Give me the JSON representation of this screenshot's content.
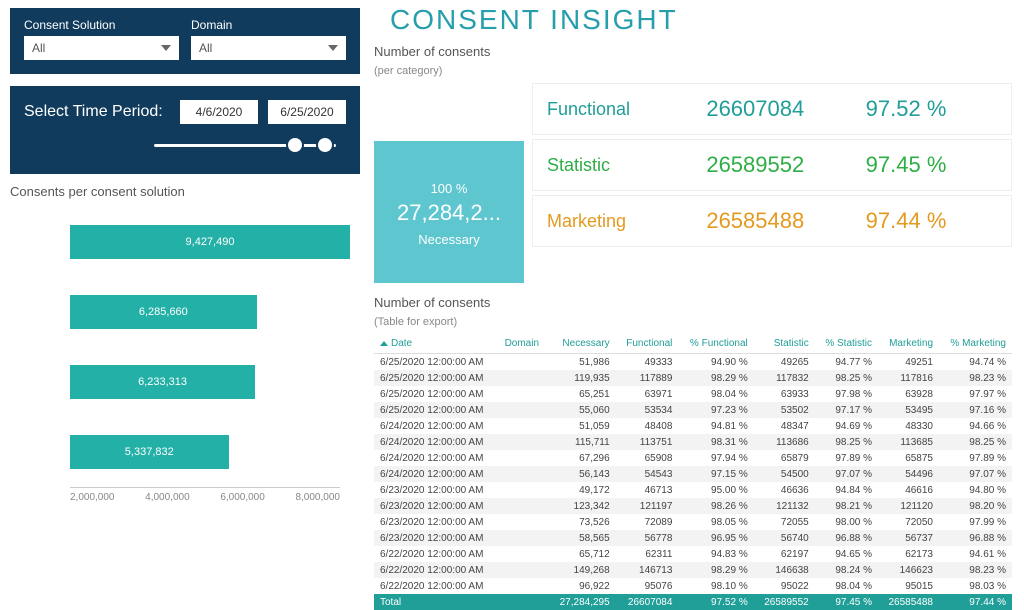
{
  "title": "CONSENT INSIGHT",
  "filters": {
    "consent_solution_label": "Consent Solution",
    "consent_solution_value": "All",
    "domain_label": "Domain",
    "domain_value": "All"
  },
  "time": {
    "title": "Select Time Period:",
    "start": "4/6/2020",
    "end": "6/25/2020"
  },
  "sections": {
    "bar_title": "Consents per consent solution",
    "kpi_title": "Number of consents",
    "kpi_sub": "(per category)",
    "table_title": "Number of consents",
    "table_sub": "(Table for export)"
  },
  "necessary": {
    "pct": "100 %",
    "value": "27,284,2...",
    "label": "Necessary"
  },
  "kpis": [
    {
      "name": "Functional",
      "value": "26607084",
      "pct": "97.52 %",
      "cls": "c-func"
    },
    {
      "name": "Statistic",
      "value": "26589552",
      "pct": "97.45 %",
      "cls": "c-stat"
    },
    {
      "name": "Marketing",
      "value": "26585488",
      "pct": "97.44 %",
      "cls": "c-mkt"
    }
  ],
  "chart_data": {
    "type": "bar",
    "orientation": "horizontal",
    "xlabel": "",
    "ylabel": "",
    "x_ticks": [
      "2,000,000",
      "4,000,000",
      "6,000,000",
      "8,000,000"
    ],
    "values": [
      9427490,
      6285660,
      6233313,
      5337832
    ],
    "labels": [
      "9,427,490",
      "6,285,660",
      "6,233,313",
      "5,337,832"
    ]
  },
  "table": {
    "columns": [
      "Date",
      "Domain",
      "Necessary",
      "Functional",
      "% Functional",
      "Statistic",
      "% Statistic",
      "Marketing",
      "% Marketing"
    ],
    "rows": [
      [
        "6/25/2020 12:00:00 AM",
        "",
        "51,986",
        "49333",
        "94.90 %",
        "49265",
        "94.77 %",
        "49251",
        "94.74 %"
      ],
      [
        "6/25/2020 12:00:00 AM",
        "",
        "119,935",
        "117889",
        "98.29 %",
        "117832",
        "98.25 %",
        "117816",
        "98.23 %"
      ],
      [
        "6/25/2020 12:00:00 AM",
        "",
        "65,251",
        "63971",
        "98.04 %",
        "63933",
        "97.98 %",
        "63928",
        "97.97 %"
      ],
      [
        "6/25/2020 12:00:00 AM",
        "",
        "55,060",
        "53534",
        "97.23 %",
        "53502",
        "97.17 %",
        "53495",
        "97.16 %"
      ],
      [
        "6/24/2020 12:00:00 AM",
        "",
        "51,059",
        "48408",
        "94.81 %",
        "48347",
        "94.69 %",
        "48330",
        "94.66 %"
      ],
      [
        "6/24/2020 12:00:00 AM",
        "",
        "115,711",
        "113751",
        "98.31 %",
        "113686",
        "98.25 %",
        "113685",
        "98.25 %"
      ],
      [
        "6/24/2020 12:00:00 AM",
        "",
        "67,296",
        "65908",
        "97.94 %",
        "65879",
        "97.89 %",
        "65875",
        "97.89 %"
      ],
      [
        "6/24/2020 12:00:00 AM",
        "",
        "56,143",
        "54543",
        "97.15 %",
        "54500",
        "97.07 %",
        "54496",
        "97.07 %"
      ],
      [
        "6/23/2020 12:00:00 AM",
        "",
        "49,172",
        "46713",
        "95.00 %",
        "46636",
        "94.84 %",
        "46616",
        "94.80 %"
      ],
      [
        "6/23/2020 12:00:00 AM",
        "",
        "123,342",
        "121197",
        "98.26 %",
        "121132",
        "98.21 %",
        "121120",
        "98.20 %"
      ],
      [
        "6/23/2020 12:00:00 AM",
        "",
        "73,526",
        "72089",
        "98.05 %",
        "72055",
        "98.00 %",
        "72050",
        "97.99 %"
      ],
      [
        "6/23/2020 12:00:00 AM",
        "",
        "58,565",
        "56778",
        "96.95 %",
        "56740",
        "96.88 %",
        "56737",
        "96.88 %"
      ],
      [
        "6/22/2020 12:00:00 AM",
        "",
        "65,712",
        "62311",
        "94.83 %",
        "62197",
        "94.65 %",
        "62173",
        "94.61 %"
      ],
      [
        "6/22/2020 12:00:00 AM",
        "",
        "149,268",
        "146713",
        "98.29 %",
        "146638",
        "98.24 %",
        "146623",
        "98.23 %"
      ],
      [
        "6/22/2020 12:00:00 AM",
        "",
        "96,922",
        "95076",
        "98.10 %",
        "95022",
        "98.04 %",
        "95015",
        "98.03 %"
      ]
    ],
    "total": [
      "Total",
      "",
      "27,284,295",
      "26607084",
      "97.52 %",
      "26589552",
      "97.45 %",
      "26585488",
      "97.44 %"
    ]
  }
}
